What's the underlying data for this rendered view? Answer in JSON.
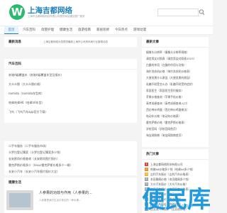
{
  "header": {
    "logo_letter": "W",
    "site_title": "上海吉都网络",
    "site_subtitle": "上海市吉都网络科技有限公司提供网站建设推广服务"
  },
  "nav": {
    "items": [
      "首页",
      "汽车百科",
      "母婴护理",
      "健康生活",
      "旅游指南",
      "家居装修",
      "今日热点",
      "游戏动漫"
    ],
    "active_index": 0
  },
  "latest": {
    "label": "最新消息",
    "text": "上海吉都网络为您提供最新上海市公司资讯和行业新闻动态"
  },
  "hot": {
    "title": "汽车百科",
    "rows": [
      "奔驰A级覆盖车（奔驰A级覆盖车型及报价）",
      "大众众颐（大众众颐价格）",
      "nomida（nomida车型库）",
      "哈弗哈弗H6（哈弗h6车型）",
      "飞鸟（飞鸟汽车app官方下载）"
    ]
  },
  "ads": {
    "rows": [
      "二手车服务（二手车服务市场）",
      "卡罗拉登记簿案（卡罗拉登记簿案多少钱）",
      "长安欧尚价格查询（长安欧尚图片报价）",
      "雷克萨斯价格多少（lexus雷克萨斯价格多少一辆）",
      "长安小汽车（长安小汽车图片报价大全）"
    ]
  },
  "img_panel": {
    "title": "健康生活",
    "item_title": "人参果的功效与作用（人参果的...",
    "item_desc": "人参果是我们生活中常见的一种水果..."
  },
  "right_top": {
    "title": "最新文章",
    "rows": [
      "摄像头分辨率（摄像头分辨率规格）",
      "清宫男女对照表（清宫男女对照表2023）",
      "白醋的作用（白醋的作用与功效）",
      "海尔洗衣机价格（海尔洗衣机价格表）",
      "大便发黑什么原因（大便发黑的原因）",
      "乳糖不耐受怎么办（乳糖不耐受的症状）",
      "家庭医生（家庭医生签约服务）",
      "苹果价格查询（苹果手机价格）",
      "高考成绩查询（高考成绩查询入口）",
      "西红柿炒鸡蛋（西红柿炒鸡蛋做法）",
      "电动车价格（电动车价格表）",
      "雷克萨斯价格（雷克萨斯价格表）",
      "学校官网（学校官网首页）",
      "淘宝网购物（淘宝网购物首页）"
    ]
  },
  "right_mid": {
    "title": "热门文章",
    "rows": [
      "上海吉都网络科技有限公司",
      "哈佛h6价格多少钱（哈弗h6多少钱）",
      "吉利汽车报价（吉利汽车价格表）",
      "本田雅阁价格（本田雅阁多少钱）",
      "大众汽车报价（大众汽车价格）",
      "丰田汽车报价（丰田汽车价格表）",
      "宝马汽车报价（宝马价格）",
      "奥迪汽车报价（奥迪价格）",
      "奔驰汽车报价（奔驰价格）",
      "比亚迪汽车报价（比亚迪价格）"
    ],
    "rank_colors": [
      "#e0463c",
      "#f08a24",
      "#f2b632",
      "#9aa5ad",
      "#9aa5ad",
      "#9aa5ad",
      "#9aa5ad",
      "#9aa5ad",
      "#9aa5ad",
      "#9aa5ad"
    ]
  },
  "watermark": {
    "text": "便民库",
    "sub": "BIANMINKU.COM"
  },
  "colors": {
    "brand": "#2bb96f",
    "link": "#1b7fbd",
    "watermark": "#1f9adf"
  }
}
